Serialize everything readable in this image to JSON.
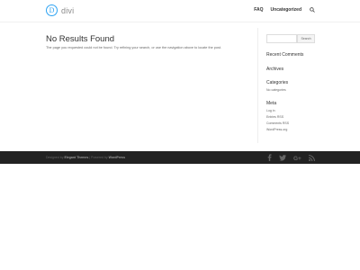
{
  "header": {
    "logo_text": "divi",
    "logo_glyph": "D",
    "nav": [
      "FAQ",
      "Uncategorized"
    ]
  },
  "main": {
    "title": "No Results Found",
    "text": "The page you requested could not be found. Try refining your search, or use the navigation above to locate the post."
  },
  "sidebar": {
    "search_button": "Search",
    "search_placeholder": "",
    "recent_comments_title": "Recent Comments",
    "archives_title": "Archives",
    "categories_title": "Categories",
    "categories_empty": "No categories",
    "meta_title": "Meta",
    "meta_links": [
      "Log in",
      "Entries RSS",
      "Comments RSS",
      "WordPress.org"
    ]
  },
  "footer": {
    "designed_by": "Designed by",
    "designer": "Elegant Themes",
    "separator": " | ",
    "powered_by": "Powered by",
    "platform": "WordPress",
    "social_icons": [
      "facebook-icon",
      "twitter-icon",
      "google-plus-icon",
      "rss-icon"
    ]
  },
  "colors": {
    "accent": "#2ea3f2",
    "footer_bg": "#222222"
  }
}
